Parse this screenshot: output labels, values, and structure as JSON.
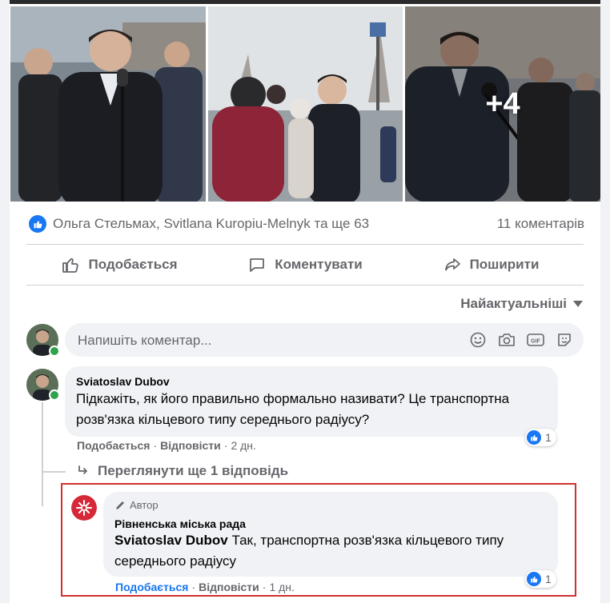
{
  "photos": {
    "more_count": "+4"
  },
  "reactions": {
    "names": "Ольга Стельмах, Svitlana Kuropiu-Melnyk та ще 63",
    "comments": "11 коментарів"
  },
  "actions": {
    "like": "Подобається",
    "comment": "Коментувати",
    "share": "Поширити"
  },
  "sort": {
    "label": "Найактуальніші"
  },
  "composer": {
    "placeholder": "Напишіть коментар..."
  },
  "comments": [
    {
      "author": "Sviatoslav Dubov",
      "text": "Підкажіть, як його правильно формально називати? Це транспортна розв'язка кільцевого типу середнього радіусу?",
      "like": "Подобається",
      "reply": "Відповісти",
      "time": "2 дн.",
      "reaction_count": "1"
    }
  ],
  "more_replies": "Переглянути ще 1 відповідь",
  "reply": {
    "badge": "Автор",
    "author": "Рівненська міська рада",
    "mention": "Sviatoslav Dubov",
    "text": "Так, транспортна розв'язка кільцевого типу середнього радіусу",
    "like": "Подобається",
    "reply": "Відповісти",
    "time": "1 дн.",
    "reaction_count": "1"
  },
  "colors": {
    "brand": "#1877f2",
    "highlight": "#d32f2f",
    "online": "#31a24c"
  }
}
